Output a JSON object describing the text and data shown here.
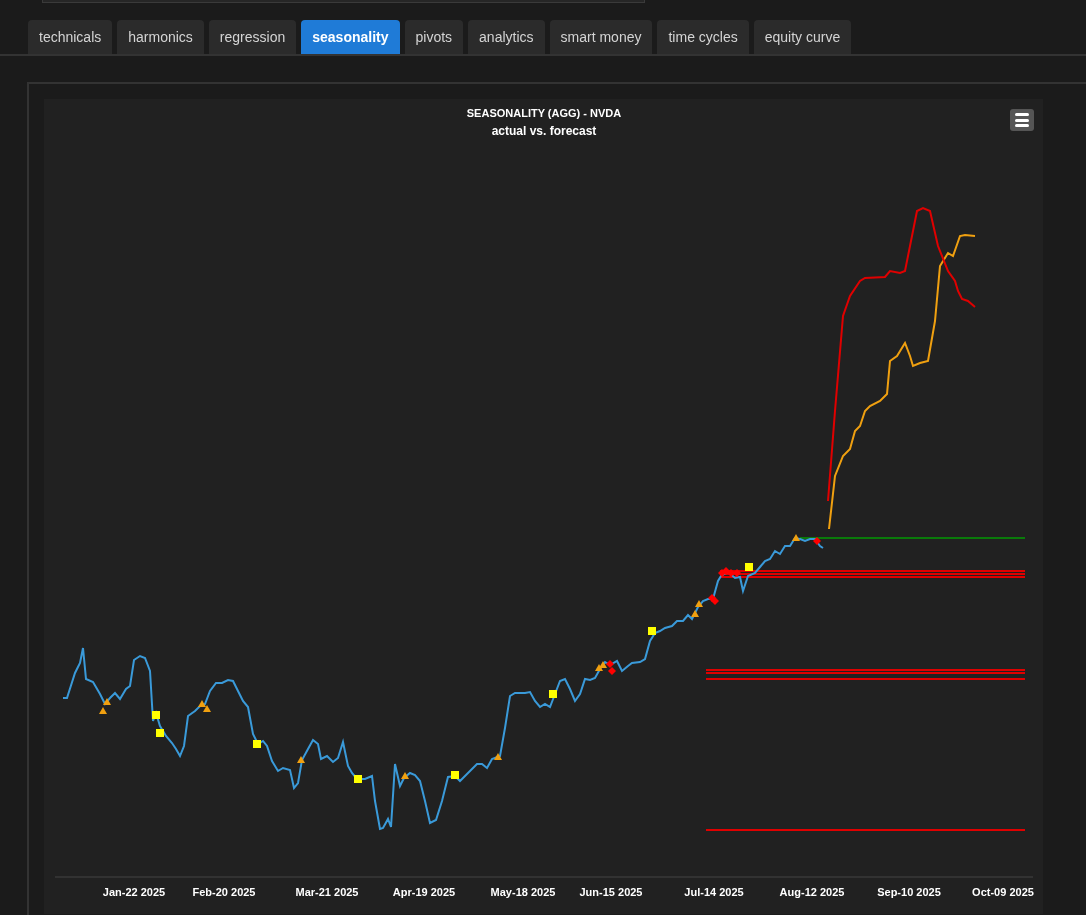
{
  "tabs": [
    {
      "label": "technicals",
      "selected": false
    },
    {
      "label": "harmonics",
      "selected": false
    },
    {
      "label": "regression",
      "selected": false
    },
    {
      "label": "seasonality",
      "selected": true
    },
    {
      "label": "pivots",
      "selected": false
    },
    {
      "label": "analytics",
      "selected": false
    },
    {
      "label": "smart money",
      "selected": false
    },
    {
      "label": "time cycles",
      "selected": false
    },
    {
      "label": "equity curve",
      "selected": false
    }
  ],
  "chart": {
    "title": "SEASONALITY (AGG) - NVDA",
    "subtitle": "actual vs. forecast",
    "x_labels": [
      "Jan-22 2025",
      "Feb-20 2025",
      "Mar-21 2025",
      "Apr-19 2025",
      "May-18 2025",
      "Jun-15 2025",
      "Jul-14 2025",
      "Aug-12 2025",
      "Sep-10 2025",
      "Oct-09 2025"
    ]
  }
}
